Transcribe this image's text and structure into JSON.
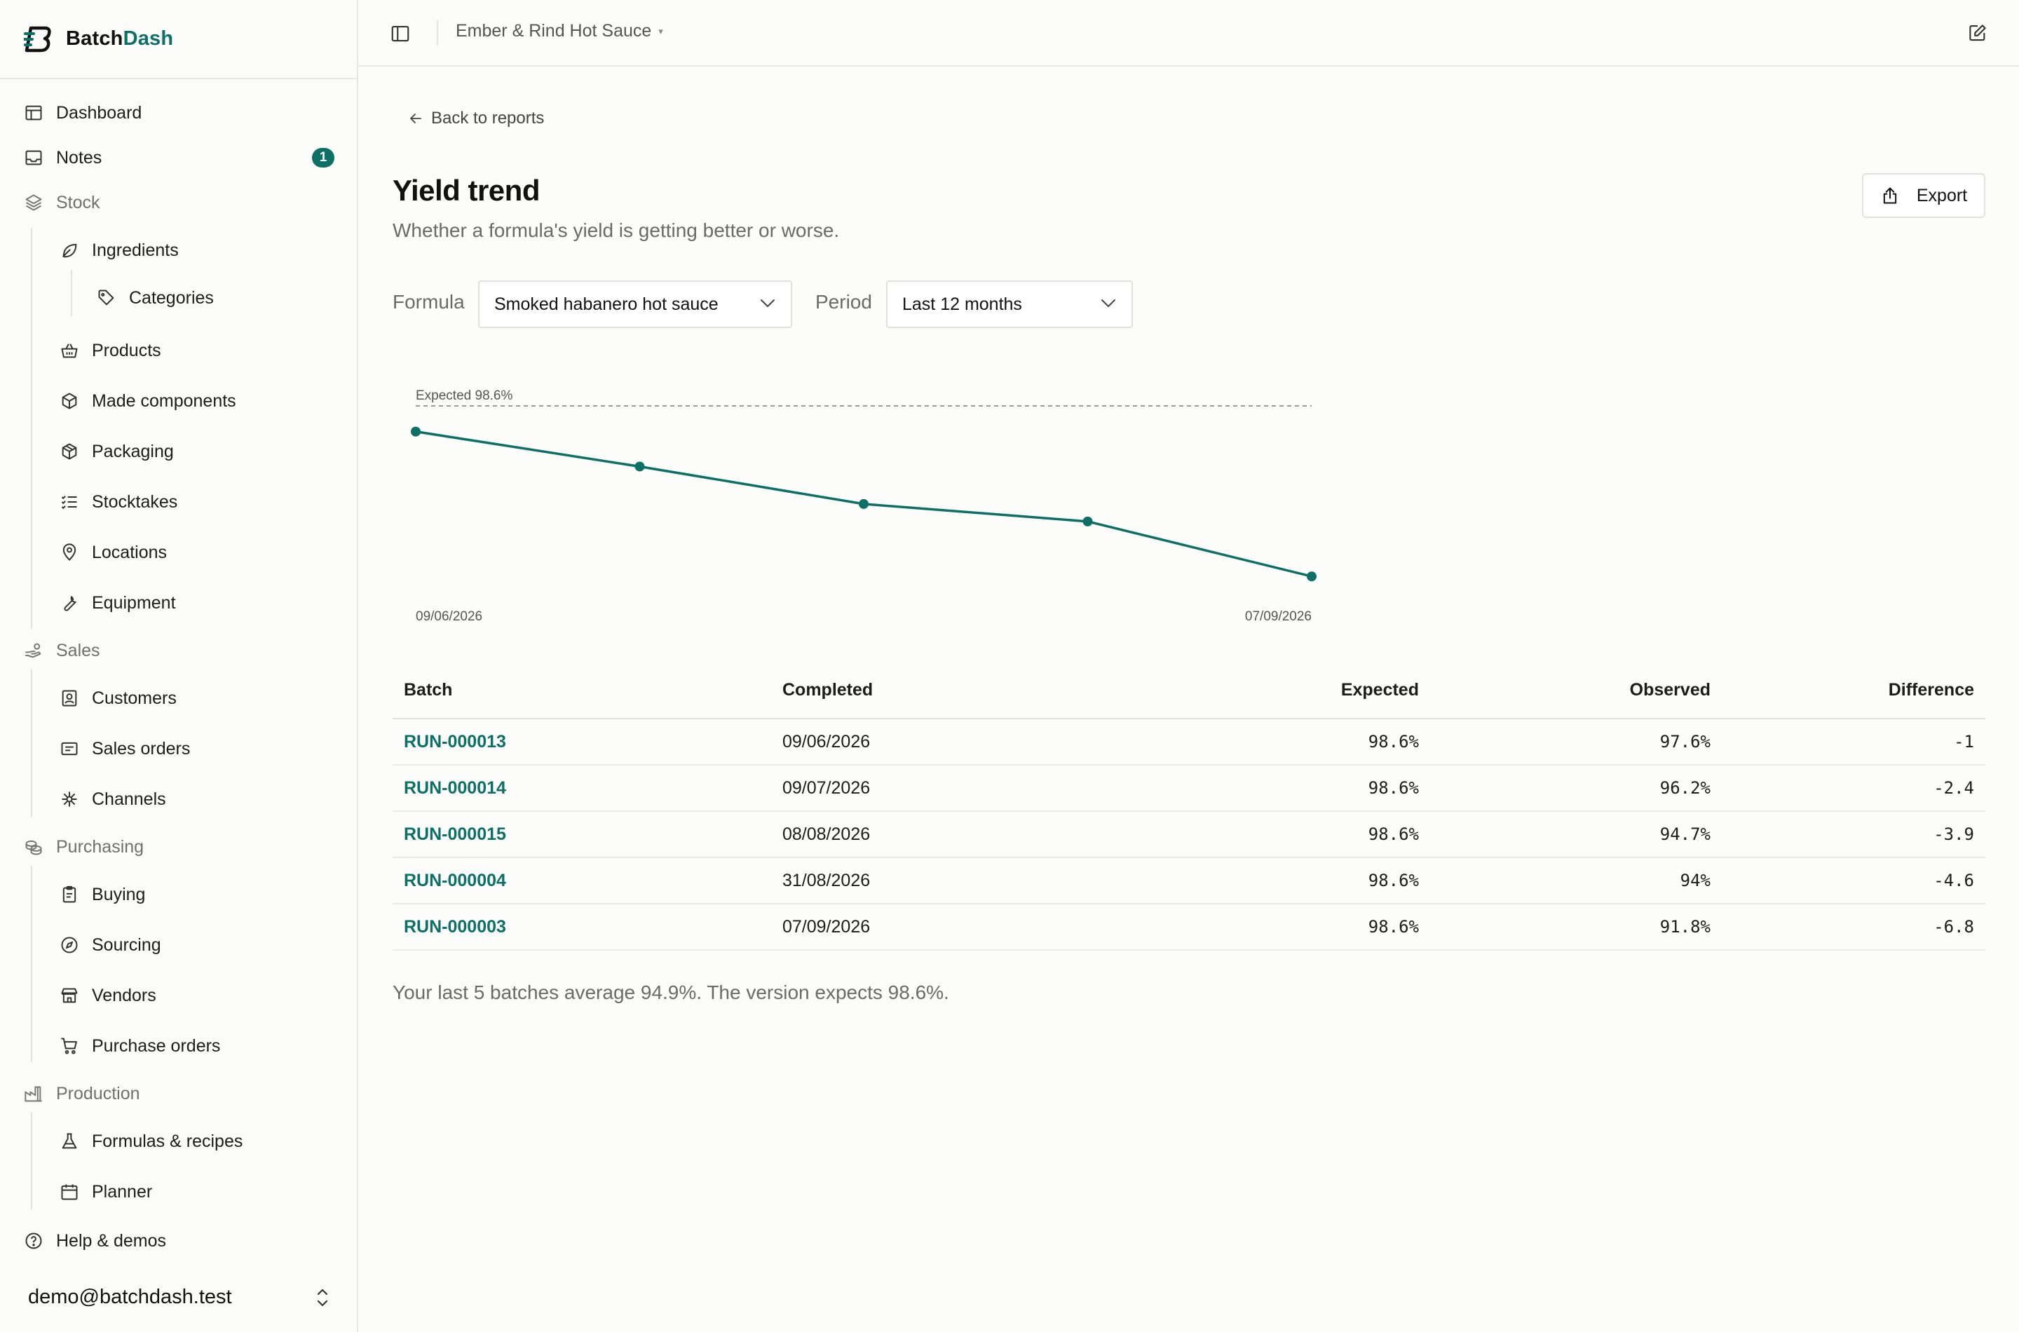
{
  "brand": {
    "name_prefix": "Batch",
    "name_suffix": "Dash"
  },
  "sidebar": {
    "dashboard": "Dashboard",
    "notes": "Notes",
    "notes_badge": "1",
    "stock": "Stock",
    "ingredients": "Ingredients",
    "categories": "Categories",
    "products": "Products",
    "made_components": "Made components",
    "packaging": "Packaging",
    "stocktakes": "Stocktakes",
    "locations": "Locations",
    "equipment": "Equipment",
    "sales": "Sales",
    "customers": "Customers",
    "sales_orders": "Sales orders",
    "channels": "Channels",
    "purchasing": "Purchasing",
    "buying": "Buying",
    "sourcing": "Sourcing",
    "vendors": "Vendors",
    "purchase_orders": "Purchase orders",
    "production": "Production",
    "formulas": "Formulas & recipes",
    "planner": "Planner",
    "help": "Help & demos",
    "account_email": "demo@batchdash.test"
  },
  "topbar": {
    "workspace": "Ember & Rind Hot Sauce",
    "caret": "▾"
  },
  "page": {
    "back_label": "Back to reports",
    "title": "Yield trend",
    "subtitle": "Whether a formula's yield is getting better or worse.",
    "export_label": "Export",
    "formula_label": "Formula",
    "formula_value": "Smoked habanero hot sauce",
    "period_label": "Period",
    "period_value": "Last 12 months",
    "summary": "Your last 5 batches average 94.9%. The version expects 98.6%."
  },
  "chart_data": {
    "type": "line",
    "x": [
      "09/06/2026",
      "09/07/2026",
      "08/08/2026",
      "31/08/2026",
      "07/09/2026"
    ],
    "series": [
      {
        "values": [
          97.6,
          96.2,
          94.7,
          94.0,
          91.8
        ]
      }
    ],
    "reference_line": {
      "label": "Expected 98.6%",
      "value": 98.6
    },
    "x_tick_labels": [
      "09/06/2026",
      "07/09/2026"
    ],
    "accent": "#0d7066",
    "grid": false
  },
  "table": {
    "headers": [
      "Batch",
      "Completed",
      "Expected",
      "Observed",
      "Difference"
    ],
    "rows": [
      [
        "RUN-000013",
        "09/06/2026",
        "98.6%",
        "97.6%",
        "-1"
      ],
      [
        "RUN-000014",
        "09/07/2026",
        "98.6%",
        "96.2%",
        "-2.4"
      ],
      [
        "RUN-000015",
        "08/08/2026",
        "98.6%",
        "94.7%",
        "-3.9"
      ],
      [
        "RUN-000004",
        "31/08/2026",
        "98.6%",
        "94%",
        "-4.6"
      ],
      [
        "RUN-000003",
        "07/09/2026",
        "98.6%",
        "91.8%",
        "-6.8"
      ]
    ]
  }
}
